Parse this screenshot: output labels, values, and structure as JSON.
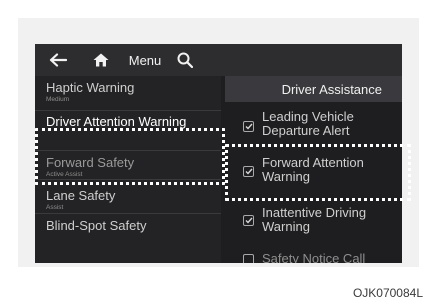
{
  "topbar": {
    "back_icon": "arrow-left-icon",
    "home_icon": "home-icon",
    "menu_label": "Menu",
    "search_icon": "search-icon"
  },
  "header": {
    "title": "Driver Assistance"
  },
  "menu": {
    "items": [
      {
        "label": "Haptic Warning",
        "sub": "Medium"
      },
      {
        "label": "Driver Attention Warning",
        "sub": "",
        "selected": true
      },
      {
        "label": "Forward Safety",
        "sub": "Active Assist"
      },
      {
        "label": "Lane Safety",
        "sub": "Assist"
      },
      {
        "label": "Blind-Spot Safety",
        "sub": ""
      }
    ]
  },
  "options": [
    {
      "label": "Leading Vehicle Departure Alert",
      "checked": true
    },
    {
      "label": "Forward Attention Warning",
      "checked": true,
      "highlighted": true
    },
    {
      "label": "Inattentive Driving Warning",
      "checked": true
    },
    {
      "label": "Safety Notice Call",
      "checked": false
    }
  ],
  "caption": {
    "code": "OJK070084L"
  },
  "colors": {
    "screen_bg": "#1e1e20",
    "highlight": "#ffffff"
  }
}
